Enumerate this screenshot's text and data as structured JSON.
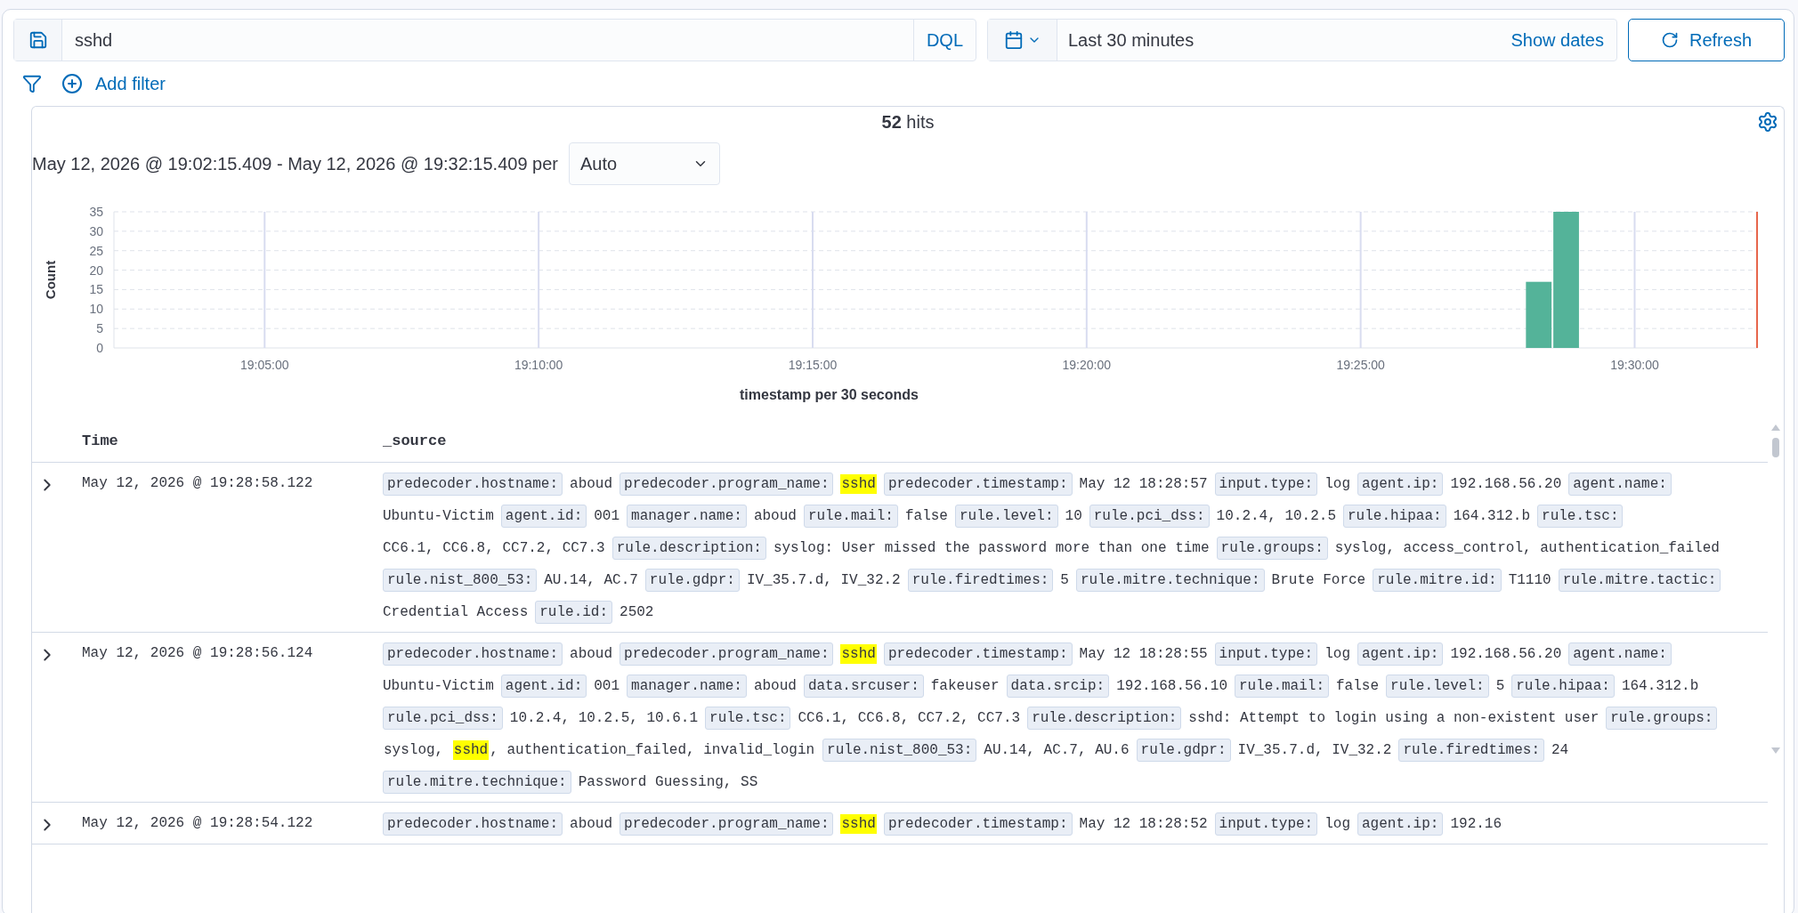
{
  "query_bar": {
    "query": "sshd",
    "language": "DQL",
    "date_range": "Last 30 minutes",
    "show_dates": "Show dates",
    "refresh": "Refresh"
  },
  "filter_bar": {
    "add_filter": "Add filter"
  },
  "results": {
    "hits": "**52** hits",
    "interval_label": "May 12, 2026 @ 19:02:15.409 - May 12, 2026 @ 19:32:15.409 per",
    "interval": "Auto",
    "chart_data": {
      "type": "bar",
      "xlabel": "timestamp per 30 seconds",
      "ylabel": "Count",
      "categories": [
        null,
        null,
        null,
        null,
        null,
        null,
        "19:05:00",
        null,
        null,
        null,
        null,
        null,
        null,
        null,
        null,
        null,
        "19:10:00",
        null,
        null,
        null,
        null,
        null,
        null,
        null,
        null,
        null,
        "19:15:00",
        null,
        null,
        null,
        null,
        null,
        null,
        null,
        null,
        null,
        "19:20:00",
        null,
        null,
        null,
        null,
        null,
        null,
        null,
        null,
        null,
        "19:25:00",
        null,
        null,
        null,
        null,
        null,
        null,
        null,
        null,
        null,
        "19:30:00",
        null,
        null,
        null,
        null
      ],
      "series": [
        {
          "color": "#54b399",
          "values": [
            null,
            null,
            null,
            null,
            null,
            null,
            null,
            null,
            null,
            null,
            null,
            null,
            null,
            null,
            null,
            null,
            null,
            null,
            null,
            null,
            null,
            null,
            null,
            null,
            null,
            null,
            null,
            null,
            null,
            null,
            null,
            null,
            null,
            null,
            null,
            null,
            null,
            null,
            null,
            null,
            null,
            null,
            null,
            null,
            null,
            null,
            null,
            null,
            null,
            null,
            null,
            null,
            17,
            35,
            null,
            null,
            null,
            null,
            null,
            null,
            null
          ]
        }
      ],
      "ylim": [
        0,
        35
      ],
      "grid": true,
      "yticks": [
        0,
        5,
        10,
        15,
        20,
        25,
        30,
        35
      ]
    }
  },
  "table": {
    "columns": [
      "Time",
      "_source"
    ],
    "rows": [
      {
        "time": "May 12, 2026 @ 19:28:58.122",
        "expanded": false,
        "fields": [
          {
            "key": "predecoder.hostname:",
            "value": "aboud"
          },
          {
            "key": "predecoder.program_name:",
            "segments": [
              {
                "text": "sshd",
                "highlighted": true
              }
            ]
          },
          {
            "key": "predecoder.timestamp:",
            "value": "May 12 18:28:57"
          },
          {
            "key": "input.type:",
            "value": "log"
          },
          {
            "key": "agent.ip:",
            "value": "192.168.56.20"
          },
          {
            "key": "agent.name:",
            "value": "Ubuntu-Victim"
          },
          {
            "key": "agent.id:",
            "value": "001"
          },
          {
            "key": "manager.name:",
            "value": "aboud"
          },
          {
            "key": "rule.mail:",
            "value": "false"
          },
          {
            "key": "rule.level:",
            "value": "10"
          },
          {
            "key": "rule.pci_dss:",
            "value": "10.2.4, 10.2.5"
          },
          {
            "key": "rule.hipaa:",
            "value": "164.312.b"
          },
          {
            "key": "rule.tsc:",
            "value": "CC6.1, CC6.8, CC7.2, CC7.3"
          },
          {
            "key": "rule.description:",
            "value": "syslog: User missed the password more than one time"
          },
          {
            "key": "rule.groups:",
            "value": "syslog, access_control, authentication_failed"
          },
          {
            "key": "rule.nist_800_53:",
            "value": "AU.14, AC.7"
          },
          {
            "key": "rule.gdpr:",
            "value": "IV_35.7.d, IV_32.2"
          },
          {
            "key": "rule.firedtimes:",
            "value": "5"
          },
          {
            "key": "rule.mitre.technique:",
            "value": "Brute Force"
          },
          {
            "key": "rule.mitre.id:",
            "value": "T1110"
          },
          {
            "key": "rule.mitre.tactic:",
            "value": "Credential Access"
          },
          {
            "key": "rule.id:",
            "value": "2502"
          }
        ]
      },
      {
        "time": "May 12, 2026 @ 19:28:56.124",
        "expanded": false,
        "fields": [
          {
            "key": "predecoder.hostname:",
            "value": "aboud"
          },
          {
            "key": "predecoder.program_name:",
            "segments": [
              {
                "text": "sshd",
                "highlighted": true
              }
            ]
          },
          {
            "key": "predecoder.timestamp:",
            "value": "May 12 18:28:55"
          },
          {
            "key": "input.type:",
            "value": "log"
          },
          {
            "key": "agent.ip:",
            "value": "192.168.56.20"
          },
          {
            "key": "agent.name:",
            "value": "Ubuntu-Victim"
          },
          {
            "key": "agent.id:",
            "value": "001"
          },
          {
            "key": "manager.name:",
            "value": "aboud"
          },
          {
            "key": "data.srcuser:",
            "value": "fakeuser"
          },
          {
            "key": "data.srcip:",
            "value": "192.168.56.10"
          },
          {
            "key": "rule.mail:",
            "value": "false"
          },
          {
            "key": "rule.level:",
            "value": "5"
          },
          {
            "key": "rule.hipaa:",
            "value": "164.312.b"
          },
          {
            "key": "rule.pci_dss:",
            "value": "10.2.4, 10.2.5, 10.6.1"
          },
          {
            "key": "rule.tsc:",
            "value": "CC6.1, CC6.8, CC7.2, CC7.3"
          },
          {
            "key": "rule.description:",
            "value": "sshd: Attempt to login using a non-existent user"
          },
          {
            "key": "rule.groups:",
            "segments": [
              {
                "text": "syslog, ",
                "highlighted": false
              },
              {
                "text": "sshd",
                "highlighted": true
              },
              {
                "text": ", authentication_failed, invalid_login",
                "highlighted": false
              }
            ]
          },
          {
            "key": "rule.nist_800_53:",
            "value": "AU.14, AC.7, AU.6"
          },
          {
            "key": "rule.gdpr:",
            "value": "IV_35.7.d, IV_32.2"
          },
          {
            "key": "rule.firedtimes:",
            "value": "24"
          },
          {
            "key": "rule.mitre.technique:",
            "value": "Password Guessing, SS"
          }
        ]
      },
      {
        "time": "May 12, 2026 @ 19:28:54.122",
        "expanded": false,
        "fields": [
          {
            "key": "predecoder.hostname:",
            "value": "aboud"
          },
          {
            "key": "predecoder.program_name:",
            "segments": [
              {
                "text": "sshd",
                "highlighted": true
              }
            ]
          },
          {
            "key": "predecoder.timestamp:",
            "value": "May 12 18:28:52"
          },
          {
            "key": "input.type:",
            "value": "log"
          },
          {
            "key": "agent.ip:",
            "value": "192.16"
          }
        ]
      }
    ]
  }
}
